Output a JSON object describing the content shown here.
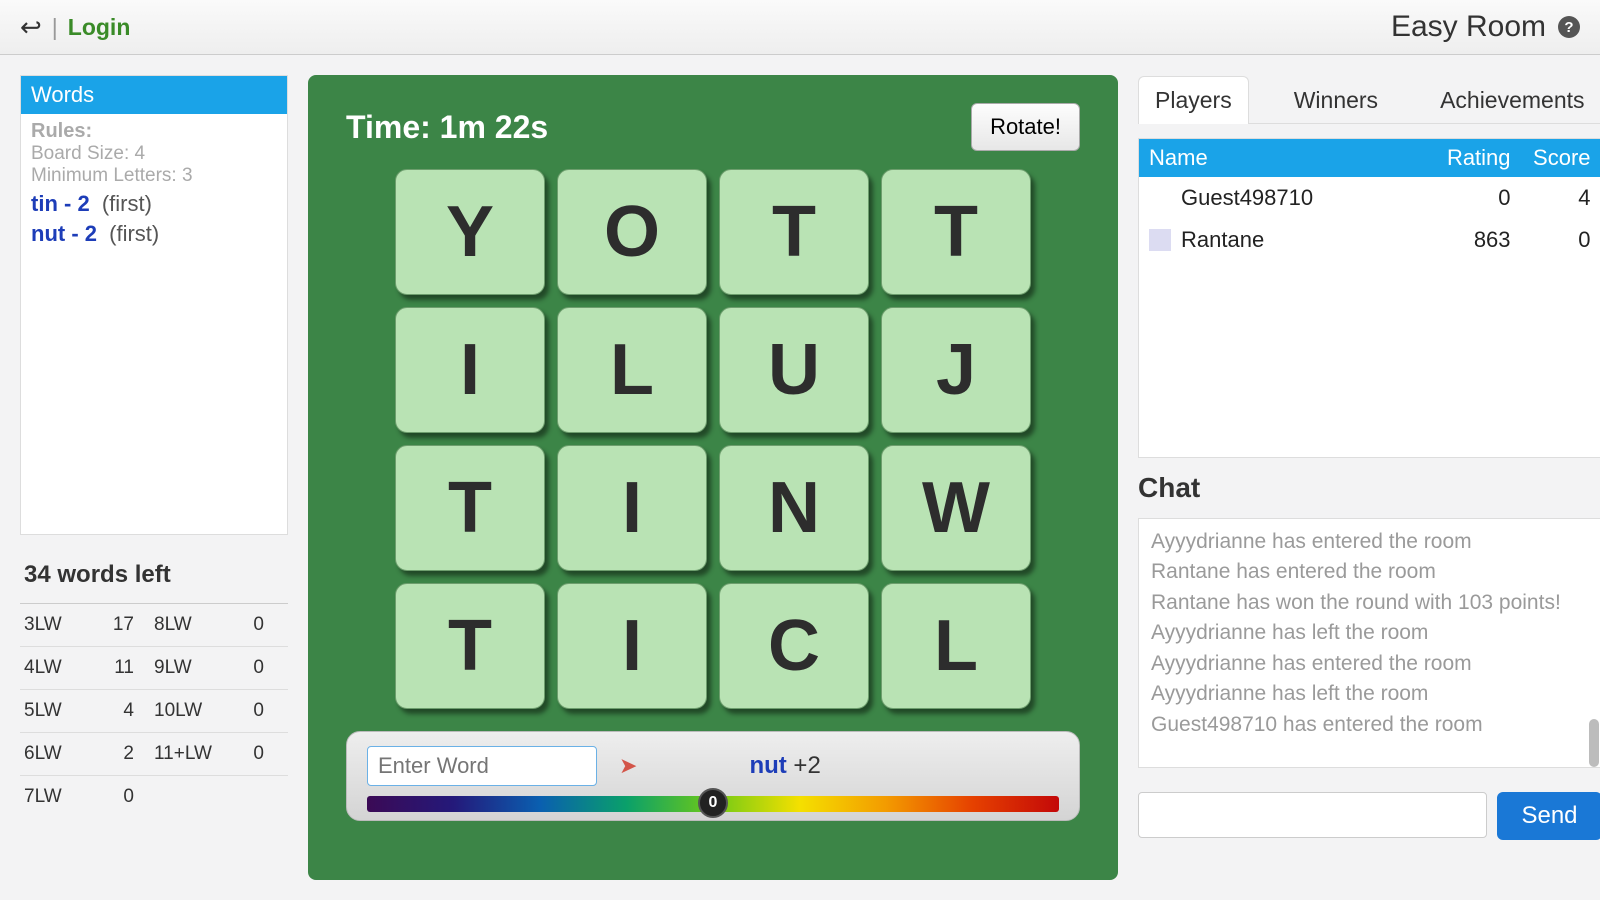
{
  "header": {
    "login": "Login",
    "room": "Easy Room"
  },
  "words": {
    "title": "Words",
    "rules_label": "Rules:",
    "board_size": "Board Size: 4",
    "min_letters": "Minimum Letters: 3",
    "found": [
      {
        "word": "tin",
        "pts": "2",
        "ann": "(first)"
      },
      {
        "word": "nut",
        "pts": "2",
        "ann": "(first)"
      }
    ]
  },
  "stats": {
    "header": "34 words left",
    "rows": [
      [
        "3LW",
        "17",
        "8LW",
        "0"
      ],
      [
        "4LW",
        "11",
        "9LW",
        "0"
      ],
      [
        "5LW",
        "4",
        "10LW",
        "0"
      ],
      [
        "6LW",
        "2",
        "11+LW",
        "0"
      ],
      [
        "7LW",
        "0",
        "",
        ""
      ]
    ]
  },
  "board": {
    "time_label": "Time: 1m 22s",
    "rotate": "Rotate!",
    "tiles": [
      "Y",
      "O",
      "T",
      "T",
      "I",
      "L",
      "U",
      "J",
      "T",
      "I",
      "N",
      "W",
      "T",
      "I",
      "C",
      "L"
    ]
  },
  "entry": {
    "placeholder": "Enter Word",
    "last_word": "nut",
    "last_pts": "+2",
    "marker": "0"
  },
  "tabs": [
    "Players",
    "Winners",
    "Achievements"
  ],
  "players": {
    "cols": {
      "name": "Name",
      "rating": "Rating",
      "score": "Score"
    },
    "rows": [
      {
        "name": "Guest498710",
        "rating": "0",
        "score": "4",
        "swatch": false
      },
      {
        "name": "Rantane",
        "rating": "863",
        "score": "0",
        "swatch": true
      }
    ]
  },
  "chat": {
    "title": "Chat",
    "lines": [
      "Ayyydrianne has entered the room",
      "Rantane has entered the room",
      "Rantane has won the round with 103 points!",
      "Ayyydrianne has left the room",
      "Ayyydrianne has entered the room",
      "Ayyydrianne has left the room",
      "Guest498710 has entered the room"
    ],
    "send": "Send"
  }
}
